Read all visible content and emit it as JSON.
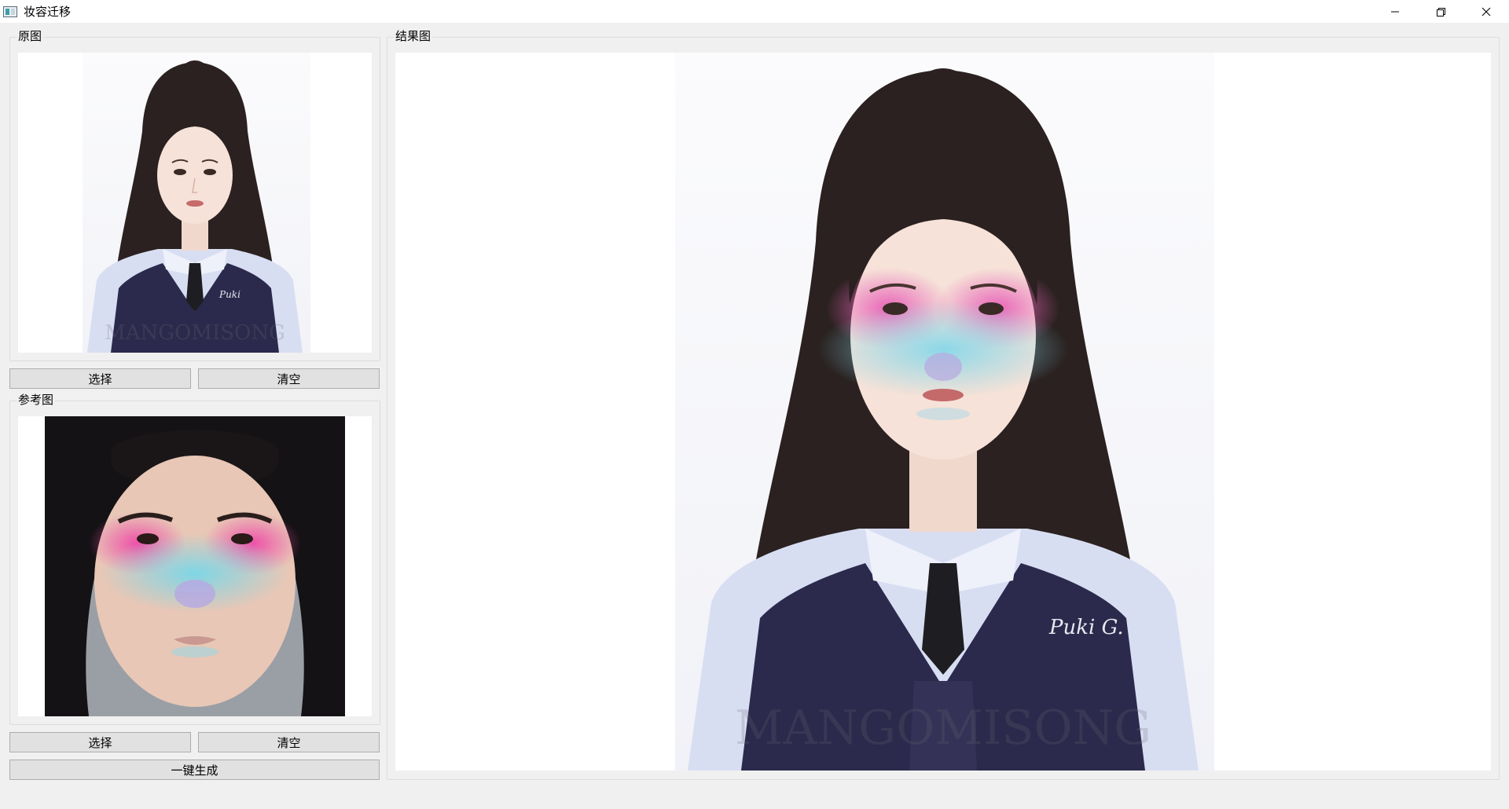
{
  "window": {
    "title": "妆容迁移"
  },
  "source_panel": {
    "title": "原图",
    "select_label": "选择",
    "clear_label": "清空"
  },
  "reference_panel": {
    "title": "参考图",
    "select_label": "选择",
    "clear_label": "清空"
  },
  "generate_label": "一键生成",
  "result_panel": {
    "title": "结果图"
  },
  "watermark": "MANGOMISONG",
  "vest_logo": "Puki G.",
  "colors": {
    "window_bg": "#f0f0f0",
    "titlebar_bg": "#ffffff",
    "button_bg": "#e1e1e1",
    "button_border": "#adadad",
    "makeup_pink": "#e864b8",
    "makeup_cyan": "#7ed6e6",
    "makeup_lilac": "#b8a8e0"
  },
  "icons": [
    "app-icon",
    "minimize-icon",
    "restore-icon",
    "close-icon"
  ]
}
